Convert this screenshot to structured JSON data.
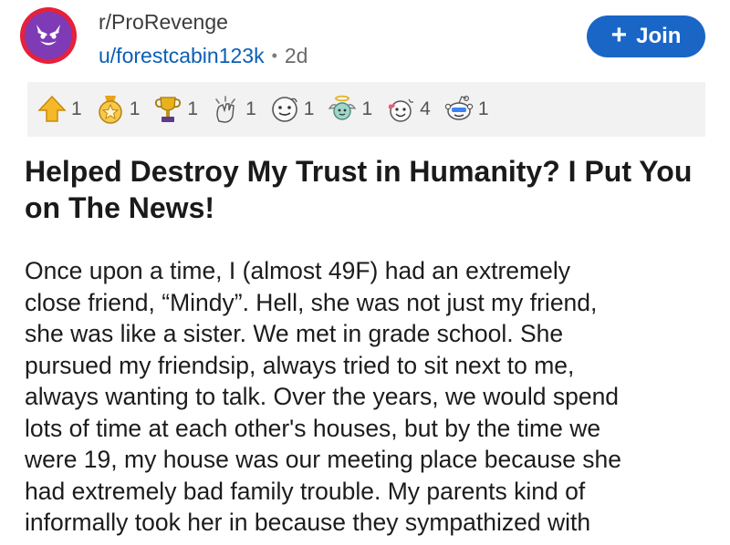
{
  "header": {
    "subreddit": "r/ProRevenge",
    "username": "u/forestcabin123k",
    "separator": "•",
    "age": "2d",
    "join_label": "Join",
    "join_icon": "+"
  },
  "colors": {
    "join_button": "#1a66c7",
    "username": "#0a5fb4",
    "icon_ring": "#e5213b",
    "icon_face": "#7e3bb5",
    "awards_bg": "#f2f2f2"
  },
  "awards": [
    {
      "icon": "upvote-award-icon",
      "count": "1"
    },
    {
      "icon": "medal-award-icon",
      "count": "1"
    },
    {
      "icon": "trophy-award-icon",
      "count": "1"
    },
    {
      "icon": "clapping-award-icon",
      "count": "1"
    },
    {
      "icon": "face-award-icon",
      "count": "1"
    },
    {
      "icon": "angel-award-icon",
      "count": "1"
    },
    {
      "icon": "wholesome-award-icon",
      "count": "4"
    },
    {
      "icon": "snoo-award-icon",
      "count": "1"
    }
  ],
  "post": {
    "title": "Helped Destroy My Trust in Humanity? I Put You on The News!",
    "body_lines": [
      "Once upon a time, I (almost 49F)  had an extremely",
      "close friend, “Mindy”. Hell, she was not just my friend,",
      "she was like a sister. We met in grade school. She",
      "pursued my friendsip, always tried to sit next to me,",
      "always wanting to talk. Over the years, we would spend",
      "lots of time at each other's houses, but by the time we",
      "were 19, my house was our meeting place because she",
      "had extremely bad family trouble. My parents kind of",
      "informally took her in because they sympathized with"
    ]
  }
}
